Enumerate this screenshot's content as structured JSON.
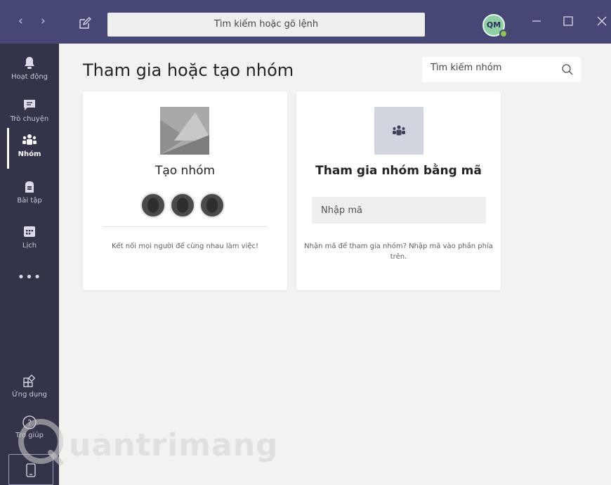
{
  "titlebar": {
    "search_placeholder": "Tìm kiếm hoặc gõ lệnh",
    "avatar_initials": "QM",
    "presence_color": "#92c353",
    "bg_color": "#464775"
  },
  "rail": {
    "items": [
      {
        "label": "Hoạt động",
        "icon": "bell-icon"
      },
      {
        "label": "Trò chuyện",
        "icon": "chat-icon"
      },
      {
        "label": "Nhóm",
        "icon": "teams-icon",
        "active": true
      },
      {
        "label": "Bài tập",
        "icon": "backpack-icon"
      },
      {
        "label": "Lịch",
        "icon": "calendar-icon"
      }
    ],
    "more_label": "•••",
    "bottom": [
      {
        "label": "Ứng dụng",
        "icon": "apps-icon"
      },
      {
        "label": "Trợ giúp",
        "icon": "help-icon"
      }
    ],
    "bg_color": "#33344a"
  },
  "main": {
    "title": "Tham gia hoặc tạo nhóm",
    "team_search_placeholder": "Tìm kiếm nhóm"
  },
  "cards": {
    "create": {
      "title": "Tạo nhóm",
      "desc": "Kết nối mọi người để cùng nhau làm việc!"
    },
    "join": {
      "title": "Tham gia nhóm bằng mã",
      "input_placeholder": "Nhập mã",
      "desc": "Nhận mã để tham gia nhóm? Nhập mã vào phần phía trên."
    }
  },
  "watermark": {
    "text": "uantrimang"
  }
}
